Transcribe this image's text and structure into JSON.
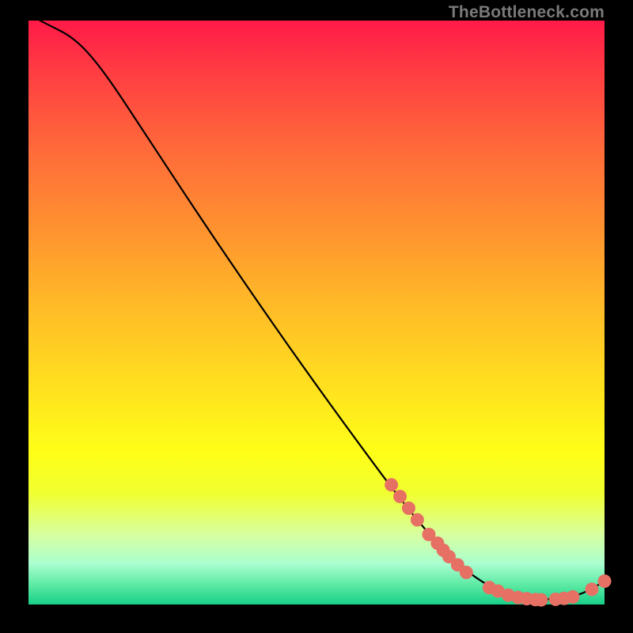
{
  "attribution": "TheBottleneck.com",
  "chart_data": {
    "type": "line",
    "title": "",
    "xlabel": "",
    "ylabel": "",
    "xlim": [
      0,
      100
    ],
    "ylim": [
      0,
      100
    ],
    "curve": [
      {
        "x": 2,
        "y": 100
      },
      {
        "x": 4,
        "y": 99
      },
      {
        "x": 7,
        "y": 97.5
      },
      {
        "x": 10,
        "y": 95
      },
      {
        "x": 14,
        "y": 90
      },
      {
        "x": 20,
        "y": 81
      },
      {
        "x": 30,
        "y": 66
      },
      {
        "x": 40,
        "y": 51.5
      },
      {
        "x": 50,
        "y": 37.5
      },
      {
        "x": 60,
        "y": 24
      },
      {
        "x": 65,
        "y": 17.5
      },
      {
        "x": 70,
        "y": 11.5
      },
      {
        "x": 75,
        "y": 6.5
      },
      {
        "x": 80,
        "y": 3
      },
      {
        "x": 85,
        "y": 1.2
      },
      {
        "x": 90,
        "y": 0.8
      },
      {
        "x": 94,
        "y": 1.2
      },
      {
        "x": 97,
        "y": 2.2
      },
      {
        "x": 100,
        "y": 4
      }
    ],
    "markers": [
      {
        "x": 63,
        "y": 20.5
      },
      {
        "x": 64.5,
        "y": 18.5
      },
      {
        "x": 66,
        "y": 16.5
      },
      {
        "x": 67.5,
        "y": 14.5
      },
      {
        "x": 69.5,
        "y": 12
      },
      {
        "x": 71,
        "y": 10.5
      },
      {
        "x": 72,
        "y": 9.3
      },
      {
        "x": 73,
        "y": 8.2
      },
      {
        "x": 74.5,
        "y": 6.8
      },
      {
        "x": 76,
        "y": 5.5
      },
      {
        "x": 80,
        "y": 2.9
      },
      {
        "x": 81.5,
        "y": 2.3
      },
      {
        "x": 83.3,
        "y": 1.6
      },
      {
        "x": 85,
        "y": 1.2
      },
      {
        "x": 86.5,
        "y": 1.0
      },
      {
        "x": 88,
        "y": 0.85
      },
      {
        "x": 89,
        "y": 0.8
      },
      {
        "x": 91.5,
        "y": 0.9
      },
      {
        "x": 93,
        "y": 1.05
      },
      {
        "x": 94.5,
        "y": 1.3
      },
      {
        "x": 97.8,
        "y": 2.6
      },
      {
        "x": 100,
        "y": 4
      }
    ],
    "marker_color": "#e77065",
    "curve_color": "#000000"
  }
}
